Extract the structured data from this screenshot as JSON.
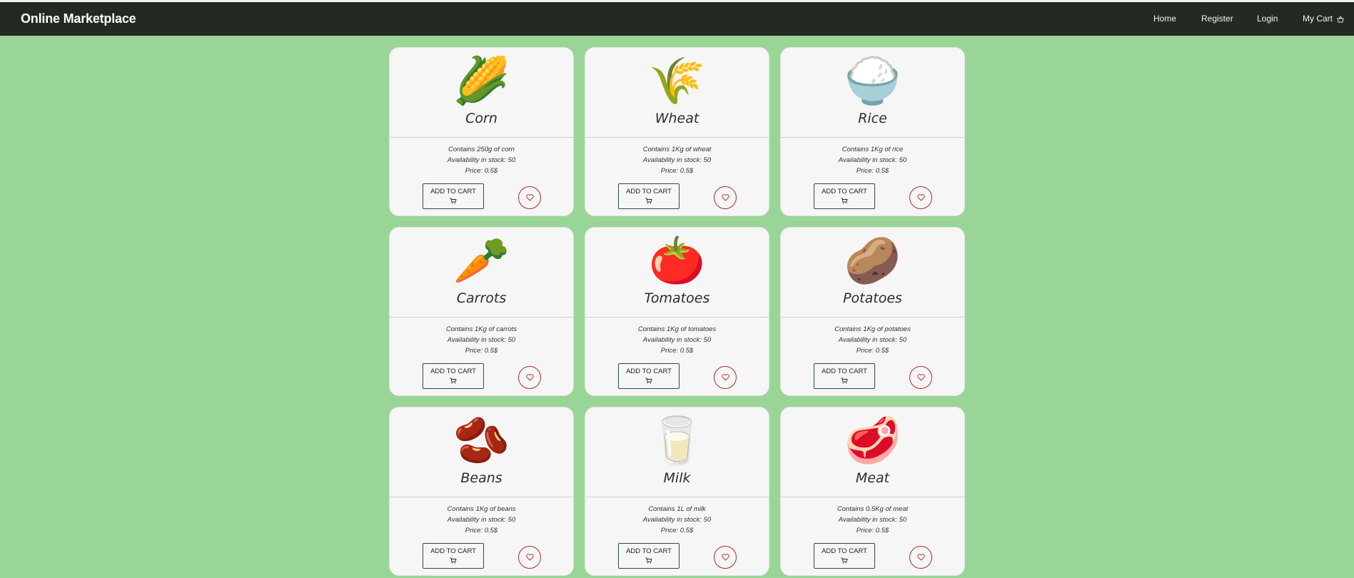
{
  "brand": "Online Marketplace",
  "nav": {
    "home": "Home",
    "register": "Register",
    "login": "Login",
    "cart": "My Cart"
  },
  "colors": {
    "background": "#99d596",
    "navbar": "#242a23",
    "card": "#f6f6f6",
    "favorite_border": "#b02a2a"
  },
  "products": [
    {
      "name": "Corn",
      "emoji": "🌽",
      "contains": "Contains 250g of corn",
      "stock": "Availability in stock: 50",
      "price": "Price: 0.5$",
      "add_label": "ADD TO CART"
    },
    {
      "name": "Wheat",
      "emoji": "🌾",
      "contains": "Contains 1Kg of wheat",
      "stock": "Availability in stock: 50",
      "price": "Price: 0.5$",
      "add_label": "ADD TO CART"
    },
    {
      "name": "Rice",
      "emoji": "🍚",
      "contains": "Contains 1Kg of rice",
      "stock": "Availability in stock: 50",
      "price": "Price: 0.5$",
      "add_label": "ADD TO CART"
    },
    {
      "name": "Carrots",
      "emoji": "🥕",
      "contains": "Contains 1Kg of carrots",
      "stock": "Availability in stock: 50",
      "price": "Price: 0.5$",
      "add_label": "ADD TO CART"
    },
    {
      "name": "Tomatoes",
      "emoji": "🍅",
      "contains": "Contains 1Kg of tomatoes",
      "stock": "Availability in stock: 50",
      "price": "Price: 0.5$",
      "add_label": "ADD TO CART"
    },
    {
      "name": "Potatoes",
      "emoji": "🥔",
      "contains": "Contains 1Kg of potatoes",
      "stock": "Availability in stock: 50",
      "price": "Price: 0.5$",
      "add_label": "ADD TO CART"
    },
    {
      "name": "Beans",
      "emoji": "🫘",
      "contains": "Contains 1Kg of beans",
      "stock": "Availability in stock: 50",
      "price": "Price: 0.5$",
      "add_label": "ADD TO CART"
    },
    {
      "name": "Milk",
      "emoji": "🥛",
      "contains": "Contains 1L of milk",
      "stock": "Availability in stock: 50",
      "price": "Price: 0.5$",
      "add_label": "ADD TO CART"
    },
    {
      "name": "Meat",
      "emoji": "🥩",
      "contains": "Contains 0.5Kg of meat",
      "stock": "Availability in stock: 50",
      "price": "Price: 0.5$",
      "add_label": "ADD TO CART"
    }
  ]
}
